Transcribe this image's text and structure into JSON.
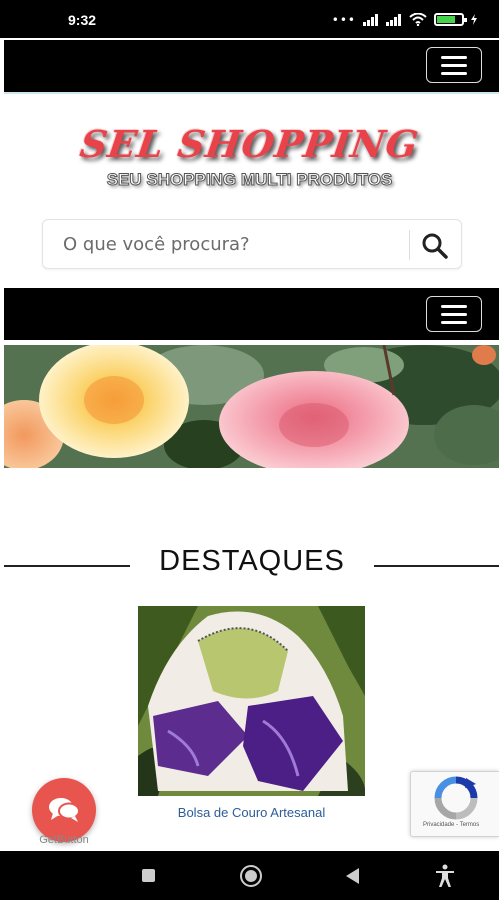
{
  "status_bar": {
    "time": "9:32",
    "icons": [
      "signal-dots-icon",
      "signal-icon",
      "signal-icon",
      "wifi-icon",
      "battery-icon",
      "charging-icon"
    ],
    "battery_color": "#44d34a"
  },
  "top_nav": {
    "menu_icon": "hamburger-menu-icon",
    "background": "#000000"
  },
  "logo": {
    "title": "SEL SHOPPING",
    "subtitle": "SEU SHOPPING MULTI PRODUTOS",
    "title_color": "#e8424a"
  },
  "search": {
    "placeholder": "O que você procura?",
    "value": "",
    "icon": "search-icon"
  },
  "menu_bar": {
    "menu_icon": "hamburger-menu-icon"
  },
  "banner": {
    "description_icon": "roses-banner-image"
  },
  "section": {
    "title": "DESTAQUES"
  },
  "products": [
    {
      "name": "Bolsa de Couro Artesanal",
      "image": "bag-product-image"
    }
  ],
  "get_button": {
    "label": "GetButton",
    "icon": "chat-bubbles-icon",
    "color": "#e8554e"
  },
  "recaptcha": {
    "footer": "Privacidade - Termos",
    "icon": "recaptcha-logo-icon"
  },
  "android_nav": {
    "buttons": [
      "recent-apps-icon",
      "home-icon",
      "back-icon",
      "accessibility-icon"
    ]
  }
}
